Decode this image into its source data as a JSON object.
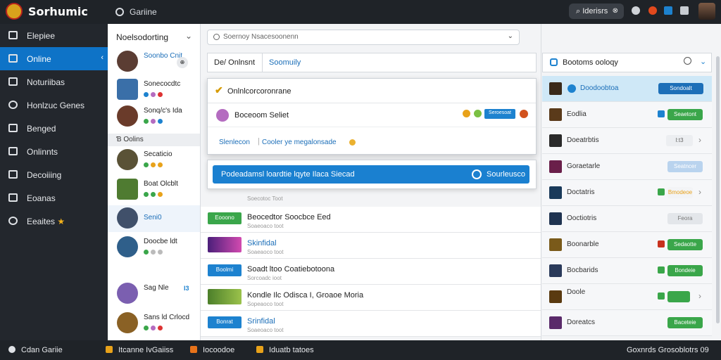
{
  "app": {
    "title": "Sorhumic"
  },
  "topbar": {
    "tab_label": "Gariine",
    "search_text": "Iderisrs",
    "search_clear": "⊗"
  },
  "sidebar": {
    "items": [
      {
        "label": "Elepiee"
      },
      {
        "label": "Online"
      },
      {
        "label": "Noturiibas"
      },
      {
        "label": "Honlzuc Genes"
      },
      {
        "label": "Benged"
      },
      {
        "label": "Onlinnts"
      },
      {
        "label": "Decoiiing"
      },
      {
        "label": "Eoanas"
      },
      {
        "label": "Eeaites"
      }
    ],
    "active_arrow": "‹"
  },
  "friends": {
    "header": "Noelsodorting",
    "group_header": "Ɓ Oolins",
    "list": [
      {
        "name": "Soonbo Cnit",
        "extra": "⊕"
      },
      {
        "name": "Sonecocdtc"
      },
      {
        "name": "Sonq/c's Ida"
      },
      {
        "name": "Secaticio"
      },
      {
        "name": "Boat Olcblt"
      },
      {
        "name": "Seni0"
      },
      {
        "name": "Doocbe ldt"
      },
      {
        "name": "Sag Nle",
        "extra": "I3"
      },
      {
        "name": "Sans ld Crlocd"
      }
    ]
  },
  "main": {
    "search_placeholder": "Soernoy Nsacesoonenn",
    "tabs": [
      "De/ Onlnsnt",
      "Soomuily"
    ],
    "popup": {
      "title": "Onlnlcorcoronrane",
      "item_name": "Boceoom Seliet",
      "item_button": "Seroesoat",
      "link1": "Slenlecon",
      "separator": "|",
      "link2": "Cooler ye megalonsade"
    },
    "banner": {
      "text": "Podeadamsl loardtie lqyte Ilaca Siecad",
      "button": "Sourleusco"
    },
    "ghost_sub": "Soecotoc Toot",
    "rows": [
      {
        "thumb": "Eooono",
        "title": "Beocedtor Soocbce Eed",
        "sub": "Soaeoaco toot"
      },
      {
        "thumb": "",
        "title": "Skinfidal",
        "sub": "Soaeaoco toot"
      },
      {
        "thumb": "Boolmi",
        "title": "Soadt ltoo Coatiebotoona",
        "sub": "Sorcoadc ioot"
      },
      {
        "thumb": "",
        "title": "Kondle Ilc Odisca I, Groaoe Moria",
        "sub": "Sopeaoco toot"
      },
      {
        "thumb": "Bonrat",
        "title": "Srinfidal",
        "sub": "Soaeoaco toot"
      }
    ]
  },
  "right_panel": {
    "title": "Bootoms ooloqy",
    "games": [
      {
        "name": "Doodoobtoa",
        "button": "Sondoalt"
      },
      {
        "name": "Eodlia",
        "button": "Seaetont"
      },
      {
        "name": "Doeatrbtis",
        "button": "I:t3"
      },
      {
        "name": "Goraetarle",
        "button": "Seatncer"
      },
      {
        "name": "Doctatris",
        "button": "Bmodeoe"
      },
      {
        "name": "Ooctiotris",
        "button": "Feora"
      },
      {
        "name": "Boonarble",
        "button": "Sedaotte"
      },
      {
        "name": "Bocbarids",
        "button": "Bondeie"
      },
      {
        "name": "Doole",
        "button": ""
      },
      {
        "name": "Doreatcs",
        "button": "Baceteie"
      }
    ]
  },
  "bottombar": {
    "items": [
      "Cdan Gariie",
      "Itcanne IvGaiiss",
      "Iocoodoe",
      "Iduatb tatoes"
    ],
    "right_text": "Goxnrds Grosoblotrs 09"
  },
  "colors": {
    "accent": "#0e73c7",
    "green": "#3aa64a",
    "orange": "#e8a21a"
  }
}
